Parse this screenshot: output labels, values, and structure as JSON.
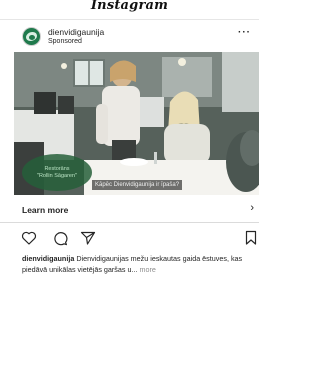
{
  "app_bar": {
    "title": "Instagram"
  },
  "post": {
    "account_name": "dienvidigaunija",
    "sponsored_label": "Sponsored",
    "more_icon": "more-horizontal-icon",
    "media": {
      "overlay_logo_line1": "Restorāns",
      "overlay_logo_line2": "\"Rollin Sāgaren\"",
      "overlay_caption": "Kāpēc Dienvidigaunija ir īpaša?"
    },
    "cta": {
      "label": "Learn more",
      "chevron": "›"
    },
    "actions": {
      "like_icon": "heart-icon",
      "comment_icon": "comment-icon",
      "share_icon": "send-icon",
      "save_icon": "bookmark-icon"
    },
    "caption": {
      "username": "dienvidigaunija",
      "text": "Dienvidigaunijas mežu ieskautas gaida ēstuves, kas piedāvā unikālas vietējās garšas u...",
      "more_label": "more"
    }
  }
}
